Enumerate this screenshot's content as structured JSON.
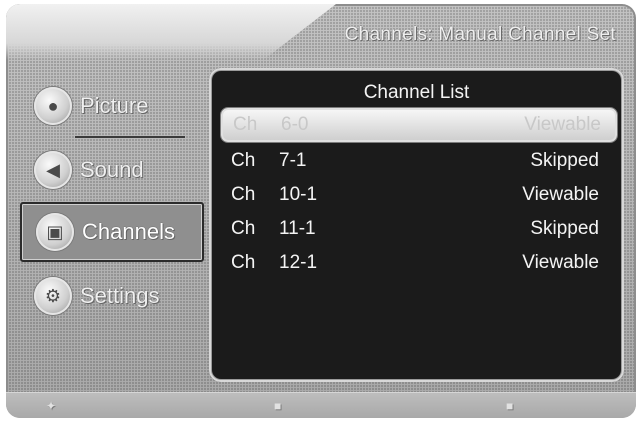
{
  "header": {
    "breadcrumb": "Channels: Manual Channel Set"
  },
  "sidebar": {
    "items": [
      {
        "label": "Picture",
        "icon": "picture-icon",
        "active": false
      },
      {
        "label": "Sound",
        "icon": "sound-icon",
        "active": false
      },
      {
        "label": "Channels",
        "icon": "channels-icon",
        "active": true
      },
      {
        "label": "Settings",
        "icon": "settings-icon",
        "active": false
      }
    ]
  },
  "panel": {
    "title": "Channel List",
    "rows": [
      {
        "prefix": "Ch",
        "number": "6-0",
        "status": "Viewable",
        "selected": true
      },
      {
        "prefix": "Ch",
        "number": "7-1",
        "status": "Skipped",
        "selected": false
      },
      {
        "prefix": "Ch",
        "number": "10-1",
        "status": "Viewable",
        "selected": false
      },
      {
        "prefix": "Ch",
        "number": "11-1",
        "status": "Skipped",
        "selected": false
      },
      {
        "prefix": "Ch",
        "number": "12-1",
        "status": "Viewable",
        "selected": false
      }
    ]
  },
  "colors": {
    "panel_background": "#1b1b1b",
    "screen_background": "#b6b6b6",
    "active_border": "#2b2b2b"
  }
}
